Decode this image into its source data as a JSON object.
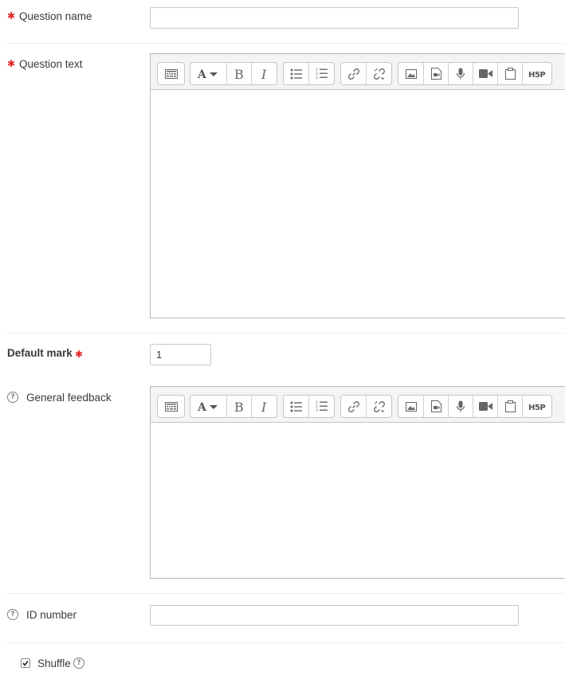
{
  "question_name": {
    "label": "Question name",
    "value": ""
  },
  "question_text": {
    "label": "Question text"
  },
  "default_mark": {
    "label": "Default mark",
    "value": "1"
  },
  "general_feedback": {
    "label": "General feedback"
  },
  "id_number": {
    "label": "ID number",
    "value": ""
  },
  "shuffle": {
    "label": "Shuffle",
    "checked": true
  },
  "toolbar": {
    "h5p_label": "H5P"
  },
  "colors": {
    "required": "#e0282d",
    "border": "#c8c8c8",
    "toolbar_bg": "#f4f4f4"
  }
}
